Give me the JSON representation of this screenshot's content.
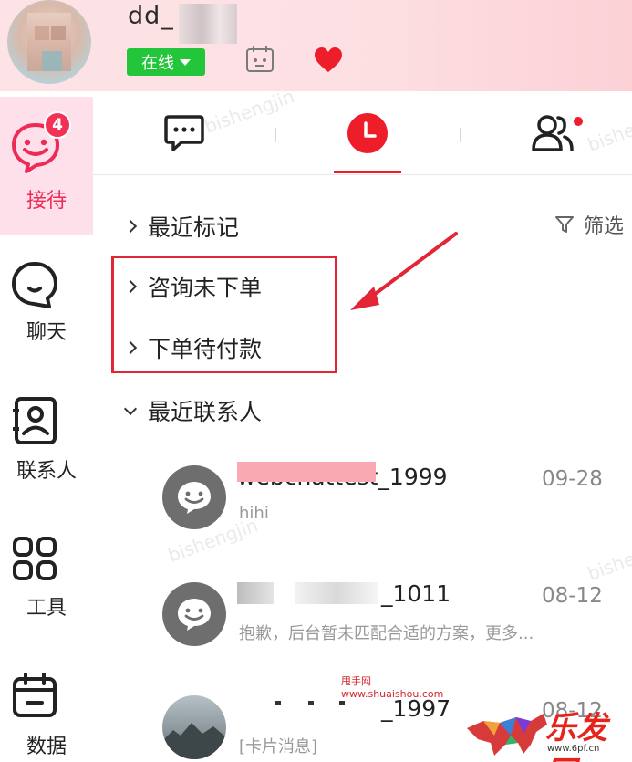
{
  "header": {
    "username": "dd_",
    "status": "在线"
  },
  "sidebar": {
    "items": [
      {
        "label": "接待",
        "badge": "4",
        "icon": "smile-chat-icon",
        "active": true
      },
      {
        "label": "聊天",
        "icon": "chat-bubble-icon"
      },
      {
        "label": "联系人",
        "icon": "contact-card-icon"
      },
      {
        "label": "工具",
        "icon": "grid-apps-icon"
      },
      {
        "label": "数据",
        "icon": "calendar-data-icon"
      }
    ]
  },
  "tabs": [
    {
      "icon": "message-dots-icon"
    },
    {
      "icon": "clock-icon",
      "active": true
    },
    {
      "icon": "users-icon",
      "dot": true
    }
  ],
  "groups": {
    "recent_marked": "最近标记",
    "consult_no_order": "咨询未下单",
    "order_unpaid": "下单待付款",
    "recent_contacts": "最近联系人"
  },
  "filter_label": "筛选",
  "contacts": [
    {
      "name": "webchattest_1999",
      "message": "hihi",
      "time": "09-28"
    },
    {
      "name": "_1011",
      "message": "抱歉，后台暂未匹配合适的方案，更多...",
      "time": "08-12"
    },
    {
      "name": "_1997",
      "message": "[卡片消息]",
      "time": "08-12"
    }
  ],
  "watermark_text": "bishengjin",
  "site_watermark": {
    "line1": "甩手网",
    "line2": "www.shuaishou.com",
    "brand": "乐发网",
    "url": "www.6pf.cn"
  },
  "colors": {
    "accent": "#ee2a56",
    "online": "#23c53a",
    "highlight": "#e32636"
  }
}
